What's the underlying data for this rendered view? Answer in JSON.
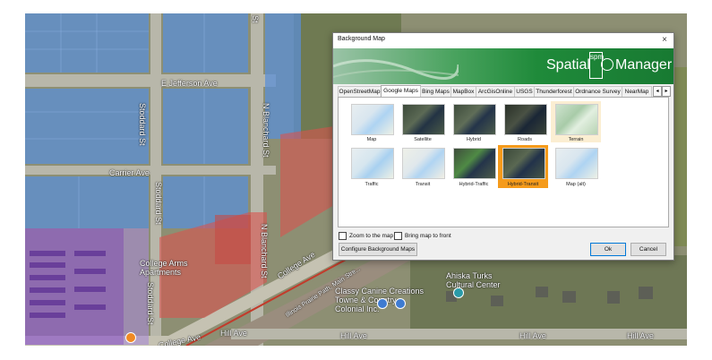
{
  "map": {
    "street_labels": {
      "jefferson": "E Jefferson Ave",
      "carrier": "Carrier Ave",
      "stoddard1": "Stoddard St",
      "stoddard2": "Stoddard St",
      "stoddard3": "Stoddard St",
      "st_top": "St",
      "blanchard1": "N Blanchard St",
      "blanchard2": "N Blanchard St",
      "college1": "College Ave",
      "college2": "College Ave",
      "hill1": "Hill Ave",
      "hill2": "Hill Ave",
      "hill3": "Hill Ave",
      "hill4": "Hill Ave",
      "main_st": "Illinois Prairie Path, Main Stre..."
    },
    "place_labels": {
      "college_apts": "College Arms Apartments",
      "ahiska": "Ahiska Turks Cultural Center",
      "classy": "Classy Canine Creations",
      "towne": "Towne & Country Colonial Inc."
    }
  },
  "dialog": {
    "title": "Background Map",
    "close": "×",
    "brand": {
      "word1": "Spatial",
      "logo": "spm",
      "word2": "Manager"
    },
    "tabs": [
      {
        "label": "OpenStreetMap",
        "active": false
      },
      {
        "label": "Google Maps",
        "active": true
      },
      {
        "label": "Bing Maps",
        "active": false
      },
      {
        "label": "MapBox",
        "active": false
      },
      {
        "label": "ArcGisOnline",
        "active": false
      },
      {
        "label": "USGS",
        "active": false
      },
      {
        "label": "Thunderforest",
        "active": false
      },
      {
        "label": "Ordnance Survey",
        "active": false
      },
      {
        "label": "NearMap",
        "active": false
      }
    ],
    "tab_scroll_left": "◂",
    "tab_scroll_right": "▸",
    "thumbnails": [
      {
        "label": "Map",
        "style": "map"
      },
      {
        "label": "Satellite",
        "style": "satellite"
      },
      {
        "label": "Hybrid",
        "style": "hybrid"
      },
      {
        "label": "Roads",
        "style": "roads"
      },
      {
        "label": "Terrain",
        "style": "terrain"
      },
      {
        "label": "Traffic",
        "style": "traffic"
      },
      {
        "label": "Transit",
        "style": "transit"
      },
      {
        "label": "Hybrid-Traffic",
        "style": "hybrid-traffic"
      },
      {
        "label": "Hybrid-Transit",
        "style": "hybrid-transit",
        "selected": true
      },
      {
        "label": "Map (alt)",
        "style": "map"
      }
    ],
    "options": {
      "zoom": "Zoom to the map",
      "bring_front": "Bring map to front"
    },
    "buttons": {
      "configure": "Configure Background Maps",
      "ok": "Ok",
      "cancel": "Cancel"
    }
  },
  "colors": {
    "blue_parcels": "#5b8fd6",
    "red_parcels": "#d9534f",
    "purple_parcels": "#8e5bc9",
    "banner_green": "#1f8a3a",
    "selected_orange": "#f59b1b"
  }
}
